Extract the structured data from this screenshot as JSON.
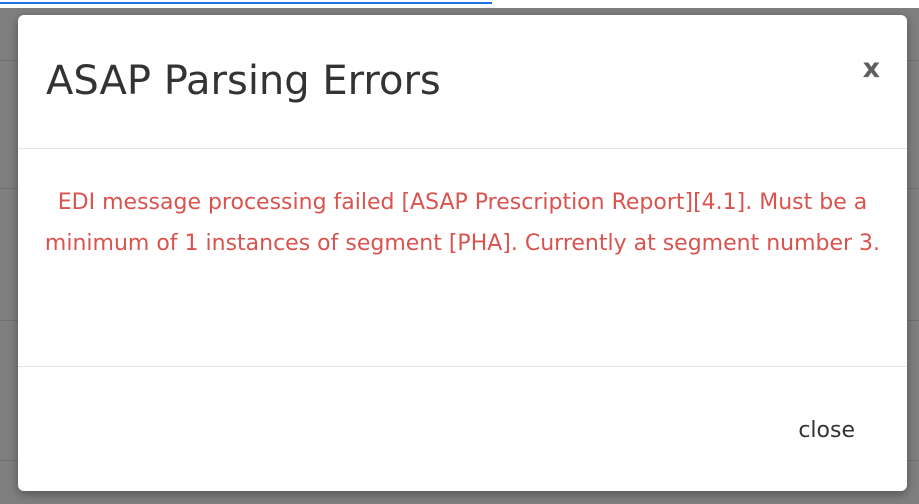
{
  "modal": {
    "title": "ASAP Parsing Errors",
    "close_icon_glyph": "x",
    "error_message": "EDI message processing failed [ASAP Prescription Report][4.1]. Must be a minimum of 1 instances of segment [PHA]. Currently at segment number 3.",
    "close_label": "close"
  },
  "colors": {
    "error_text": "#d9534f",
    "backdrop": "#7f7f7f",
    "link": "#1a73e8"
  }
}
